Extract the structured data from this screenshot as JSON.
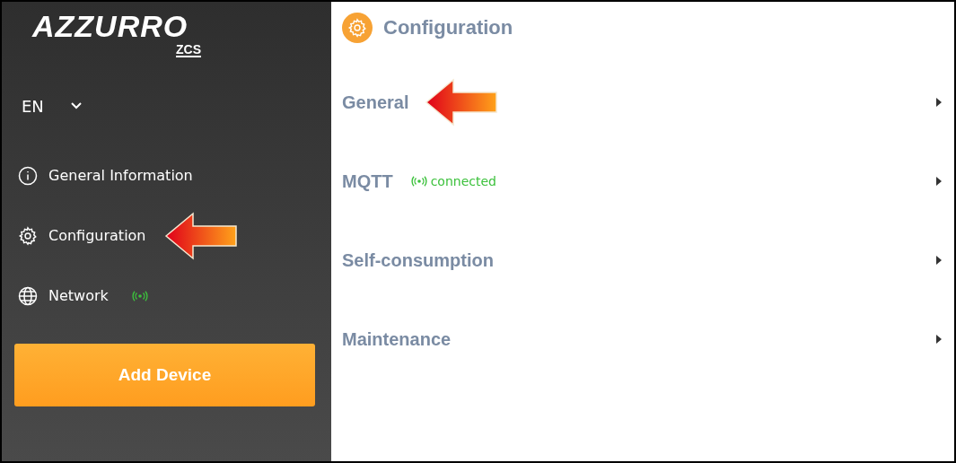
{
  "logo": {
    "name": "AZZURRO",
    "sub": "ZCS"
  },
  "language": "EN",
  "nav": [
    {
      "label": "General Information",
      "highlighted": false,
      "connected": false
    },
    {
      "label": "Configuration",
      "highlighted": true,
      "connected": false
    },
    {
      "label": "Network",
      "highlighted": false,
      "connected": true
    }
  ],
  "add_button": "Add Device",
  "page_title": "Configuration",
  "sections": [
    {
      "label": "General",
      "highlighted": true
    },
    {
      "label": "MQTT",
      "highlighted": false,
      "status": "connected"
    },
    {
      "label": "Self-consumption",
      "highlighted": false
    },
    {
      "label": "Maintenance",
      "highlighted": false
    }
  ]
}
